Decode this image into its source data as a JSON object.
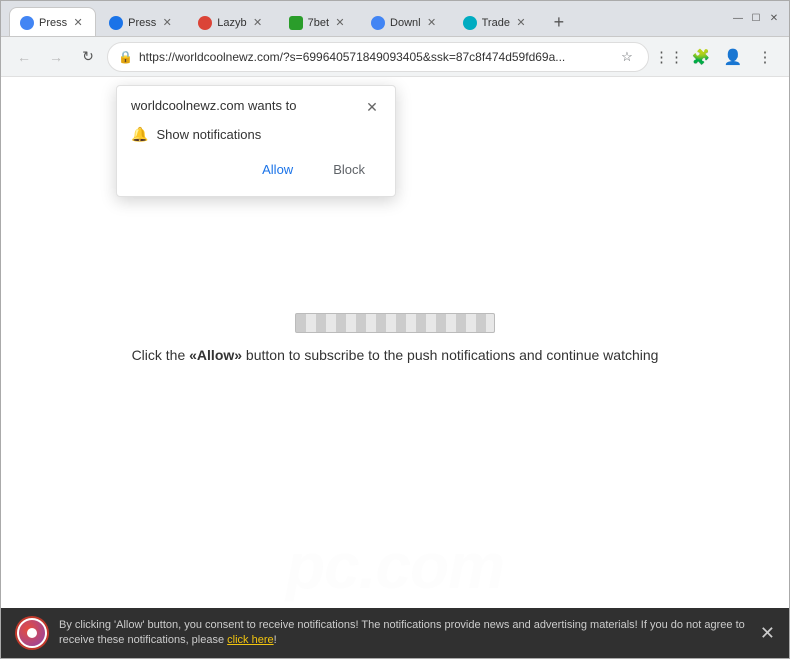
{
  "browser": {
    "tabs": [
      {
        "id": 1,
        "title": "Press",
        "favicon_color": "fav-blue",
        "active": true
      },
      {
        "id": 2,
        "title": "Press",
        "favicon_color": "fav-blue2",
        "active": false
      },
      {
        "id": 3,
        "title": "Lazyb",
        "favicon_color": "fav-red",
        "active": false
      },
      {
        "id": 4,
        "title": "7bet",
        "favicon_color": "fav-green",
        "active": false
      },
      {
        "id": 5,
        "title": "Downl",
        "favicon_color": "fav-blue",
        "active": false
      },
      {
        "id": 6,
        "title": "Trade",
        "favicon_color": "fav-teal",
        "active": false
      }
    ],
    "url": "https://worldcoolnewz.com/?s=699640571849093405&ssk=87c8f474d59fd69a...",
    "new_tab_label": "+",
    "window_controls": [
      "—",
      "☐",
      "✕"
    ]
  },
  "notification_popup": {
    "title": "worldcoolnewz.com wants to",
    "close_label": "✕",
    "permission_text": "Show notifications",
    "allow_label": "Allow",
    "block_label": "Block"
  },
  "page": {
    "instruction_prefix": "Click the ",
    "instruction_bold": "«Allow»",
    "instruction_suffix": " button to subscribe to the push notifications and continue watching",
    "watermark": "pc.com"
  },
  "bottom_bar": {
    "text_prefix": "By clicking 'Allow' button, you consent to receive notifications! The notifications provide news and advertising materials! If you do not agree to receive these notifications, please ",
    "link_text": "click here",
    "text_suffix": "!",
    "close_label": "✕"
  }
}
